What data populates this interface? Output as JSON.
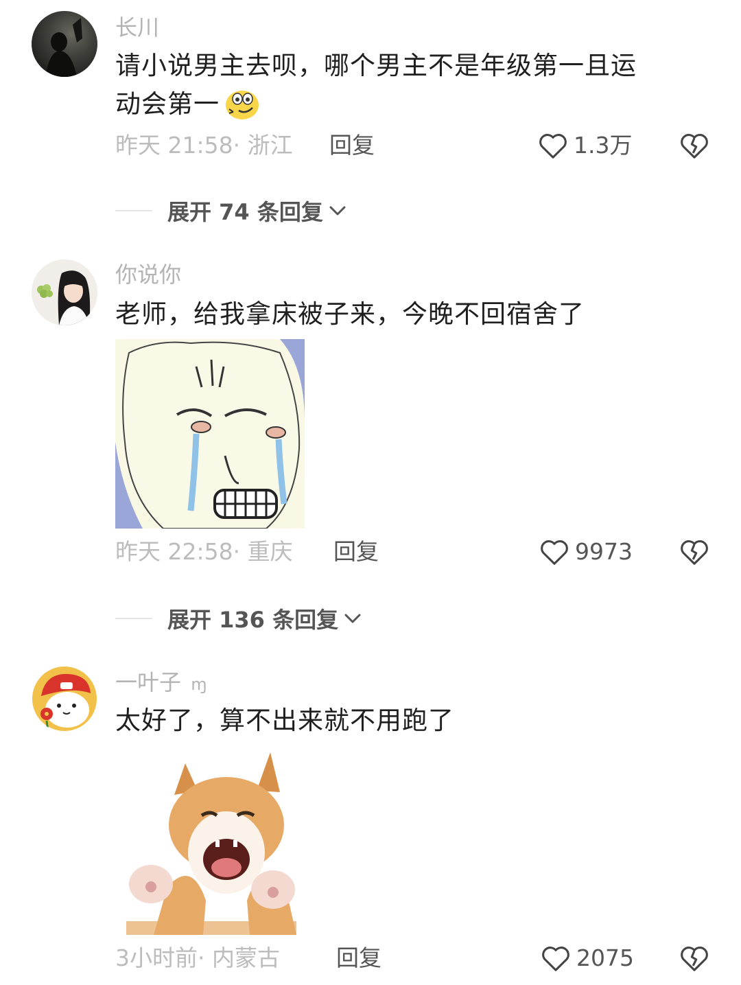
{
  "comments": [
    {
      "username": "长川",
      "text_line1": "请小说男主去呗，哪个男主不是年级第一且运",
      "text_line2": "动会第一",
      "time": "昨天 21:58",
      "location": "浙江",
      "reply": "回复",
      "likes": "1.3万",
      "expand": "展开 74 条回复"
    },
    {
      "username": "你说你",
      "text": "老师，给我拿床被子来，今晚不回宿舍了",
      "time": "昨天 22:58",
      "location": "重庆",
      "reply": "回复",
      "likes": "9973",
      "expand": "展开 136 条回复"
    },
    {
      "username": "一叶子",
      "username_suffix": "ɱ",
      "text": "太好了，算不出来就不用跑了",
      "time": "3小时前",
      "location": "内蒙古",
      "reply": "回复",
      "likes": "2075"
    }
  ],
  "meta_separator": "·",
  "icons": {
    "like": "heart-outline-icon",
    "dislike": "broken-heart-icon",
    "expand": "chevron-down-icon",
    "emoji": "dizzy-face-emoji"
  },
  "colors": {
    "text": "#1f1f1f",
    "muted": "#b4b4b4",
    "action": "#555555"
  }
}
